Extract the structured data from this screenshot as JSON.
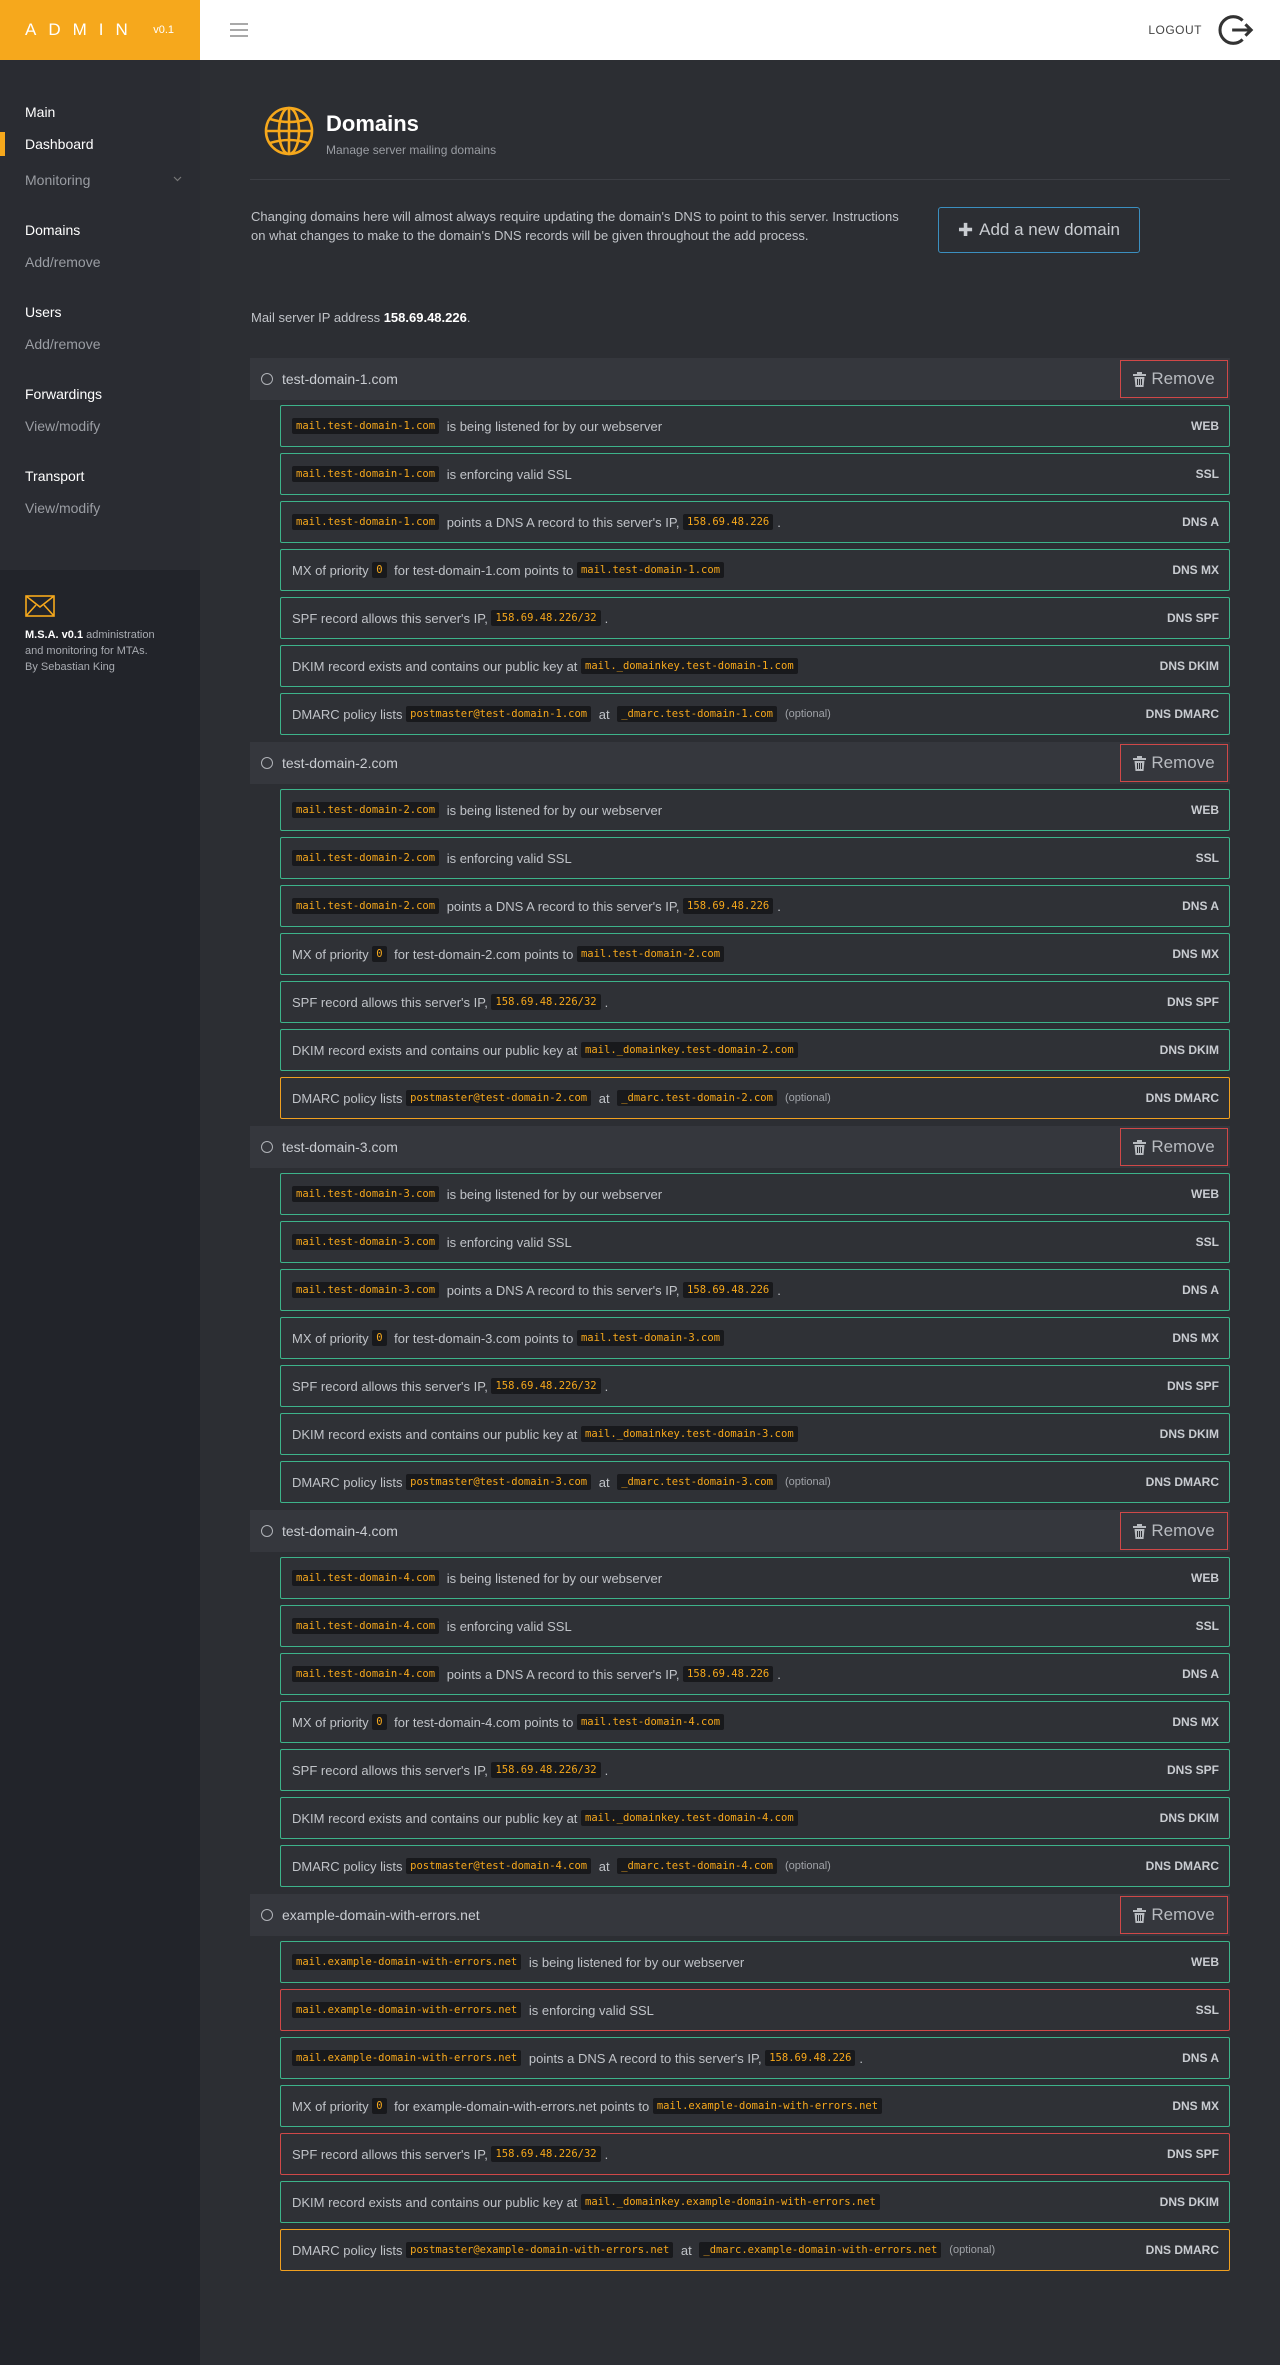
{
  "app": {
    "logo": "ADMIN",
    "version": "v0.1",
    "logout_label": "LOGOUT"
  },
  "sidebar": {
    "sections": [
      {
        "heading": "Main",
        "items": [
          {
            "label": "Dashboard",
            "active": true
          },
          {
            "label": "Monitoring",
            "chevron": "chevron-down-icon"
          }
        ]
      },
      {
        "heading": "Domains",
        "items": [
          {
            "label": "Add/remove"
          }
        ]
      },
      {
        "heading": "Users",
        "items": [
          {
            "label": "Add/remove"
          }
        ]
      },
      {
        "heading": "Forwardings",
        "items": [
          {
            "label": "View/modify"
          }
        ]
      },
      {
        "heading": "Transport",
        "items": [
          {
            "label": "View/modify"
          }
        ]
      }
    ],
    "footer": {
      "brand": "M.S.A. v0.1",
      "text1": " administration and monitoring for MTAs.",
      "text2": "By Sebastian King",
      "icon": "mail-icon"
    }
  },
  "page": {
    "title": "Domains",
    "subtitle": "Manage server mailing domains",
    "icon": "globe-icon",
    "intro": "Changing domains here will almost always require updating the domain's DNS to point to this server. Instructions on what changes to make to the domain's DNS records will be given throughout the add process.",
    "add_button": "Add a new domain",
    "ip_prefix": "Mail server IP address ",
    "ip": "158.69.48.226",
    "ip_suffix": "."
  },
  "labels": {
    "remove": "Remove",
    "web_text": " is being listened for by our webserver",
    "ssl_text": " is enforcing valid SSL",
    "a_text": " points a DNS A record to this server's IP, ",
    "mx_pre": "MX of priority ",
    "mx_for": " for ",
    "mx_points": " points to ",
    "spf_pre": "SPF record allows this server's IP, ",
    "dkim_pre": "DKIM record exists and contains our public key at ",
    "dmarc_pre": "DMARC policy lists ",
    "dmarc_at": " at ",
    "optional": "(optional)",
    "dot": ".",
    "tag_web": "WEB",
    "tag_ssl": "SSL",
    "tag_a": "DNS A",
    "tag_mx": "DNS MX",
    "tag_spf": "DNS SPF",
    "tag_dkim": "DNS DKIM",
    "tag_dmarc": "DNS DMARC"
  },
  "ip_code": "158.69.48.226",
  "spf_code": "158.69.48.226/32",
  "mx_priority": "0",
  "domains": [
    {
      "name": "test-domain-1.com",
      "mail": "mail.test-domain-1.com",
      "dkim": "mail._domainkey.test-domain-1.com",
      "postmaster": "postmaster@test-domain-1.com",
      "dmarc": "_dmarc.test-domain-1.com",
      "status": {
        "web": "ok",
        "ssl": "ok",
        "a": "ok",
        "mx": "ok",
        "spf": "ok",
        "dkim": "ok",
        "dmarc": "ok"
      }
    },
    {
      "name": "test-domain-2.com",
      "mail": "mail.test-domain-2.com",
      "dkim": "mail._domainkey.test-domain-2.com",
      "postmaster": "postmaster@test-domain-2.com",
      "dmarc": "_dmarc.test-domain-2.com",
      "status": {
        "web": "ok",
        "ssl": "ok",
        "a": "ok",
        "mx": "ok",
        "spf": "ok",
        "dkim": "ok",
        "dmarc": "warn"
      }
    },
    {
      "name": "test-domain-3.com",
      "mail": "mail.test-domain-3.com",
      "dkim": "mail._domainkey.test-domain-3.com",
      "postmaster": "postmaster@test-domain-3.com",
      "dmarc": "_dmarc.test-domain-3.com",
      "status": {
        "web": "ok",
        "ssl": "ok",
        "a": "ok",
        "mx": "ok",
        "spf": "ok",
        "dkim": "ok",
        "dmarc": "ok"
      }
    },
    {
      "name": "test-domain-4.com",
      "mail": "mail.test-domain-4.com",
      "dkim": "mail._domainkey.test-domain-4.com",
      "postmaster": "postmaster@test-domain-4.com",
      "dmarc": "_dmarc.test-domain-4.com",
      "status": {
        "web": "ok",
        "ssl": "ok",
        "a": "ok",
        "mx": "ok",
        "spf": "ok",
        "dkim": "ok",
        "dmarc": "ok"
      }
    },
    {
      "name": "example-domain-with-errors.net",
      "mail": "mail.example-domain-with-errors.net",
      "dkim": "mail._domainkey.example-domain-with-errors.net",
      "postmaster": "postmaster@example-domain-with-errors.net",
      "dmarc": "_dmarc.example-domain-with-errors.net",
      "status": {
        "web": "ok",
        "ssl": "err",
        "a": "ok",
        "mx": "ok",
        "spf": "err",
        "dkim": "ok",
        "dmarc": "warn"
      }
    }
  ],
  "colors": {
    "accent": "#f6a81c",
    "ok": "#3db38a",
    "error": "#d04848",
    "warning": "#f0a020",
    "button_border": "#3b8fc0"
  }
}
